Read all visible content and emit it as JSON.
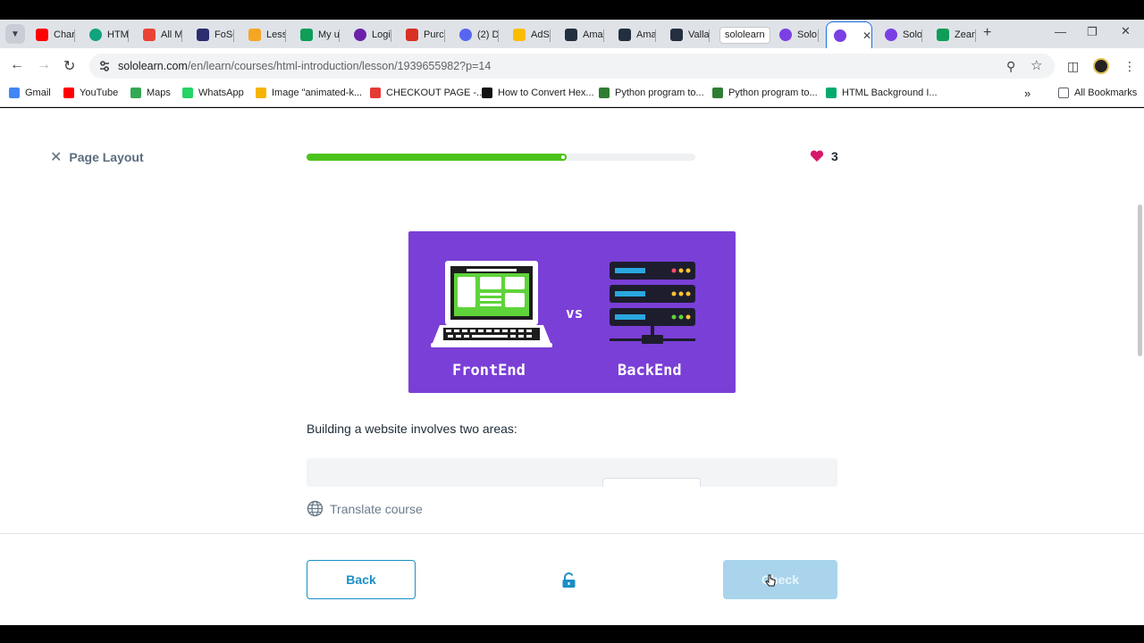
{
  "browser": {
    "tooltip": "sololearn",
    "url_host": "sololearn.com",
    "url_path": "/en/learn/courses/html-introduction/lesson/1939655982?p=14",
    "tabs": [
      {
        "label": "Char",
        "icon": "youtube-icon",
        "color": "#ff0000"
      },
      {
        "label": "HTM",
        "icon": "chatgpt-icon",
        "color": "#10a37f"
      },
      {
        "label": "All M",
        "icon": "gmail-icon",
        "color": "#ea4335"
      },
      {
        "label": "FoSC",
        "icon": "fosc-icon",
        "color": "#2b2d6e"
      },
      {
        "label": "Less",
        "icon": "pin-icon",
        "color": "#f5a623"
      },
      {
        "label": "My u",
        "icon": "sheets-icon",
        "color": "#0f9d58"
      },
      {
        "label": "Logi",
        "icon": "upwork-icon",
        "color": "#6b21a8"
      },
      {
        "label": "Purc",
        "icon": "calendar-icon",
        "color": "#d93025"
      },
      {
        "label": "(2) D",
        "icon": "discord-icon",
        "color": "#5865f2"
      },
      {
        "label": "AdSe",
        "icon": "adsense-icon",
        "color": "#fbbc04"
      },
      {
        "label": "Ama",
        "icon": "amazon-icon",
        "color": "#232f3e"
      },
      {
        "label": "Ama",
        "icon": "amazon-icon",
        "color": "#232f3e"
      },
      {
        "label": "Valla",
        "icon": "amazon-icon",
        "color": "#232f3e"
      },
      {
        "label": "Solo",
        "icon": "sololearn-icon",
        "color": "#7b3fe4"
      },
      {
        "label": "",
        "icon": "sololearn-icon",
        "color": "#7b3fe4",
        "active": true
      },
      {
        "label": "Solo",
        "icon": "sololearn-icon",
        "color": "#7b3fe4"
      },
      {
        "label": "Zean",
        "icon": "sheets-icon",
        "color": "#0f9d58"
      }
    ],
    "bookmarks": [
      {
        "label": "Gmail",
        "color": "#4285f4"
      },
      {
        "label": "YouTube",
        "color": "#ff0000"
      },
      {
        "label": "Maps",
        "color": "#34a853"
      },
      {
        "label": "WhatsApp",
        "color": "#25d366"
      },
      {
        "label": "Image \"animated-k...",
        "color": "#f5b400"
      },
      {
        "label": "CHECKOUT PAGE -...",
        "color": "#e53935"
      },
      {
        "label": "How to Convert Hex...",
        "color": "#111111"
      },
      {
        "label": "Python program to...",
        "color": "#2e7d32"
      },
      {
        "label": "Python program to...",
        "color": "#2e7d32"
      },
      {
        "label": "HTML Background I...",
        "color": "#04aa6d"
      }
    ],
    "all_bookmarks": "All Bookmarks"
  },
  "lesson": {
    "title": "Page Layout",
    "progress_fraction": 0.67,
    "lives": "3",
    "illustration": {
      "left_label": "FrontEnd",
      "middle_label": "vs",
      "right_label": "BackEnd"
    },
    "intro_text": "Building a website involves two areas:",
    "translate_label": "Translate course",
    "back_label": "Back",
    "check_label": "Check"
  },
  "colors": {
    "accent": "#1a8fc6",
    "progress": "#4cc31c",
    "illustration_bg": "#7a3fd6",
    "heart": "#d6186b",
    "check_disabled": "#a9d4ec"
  }
}
